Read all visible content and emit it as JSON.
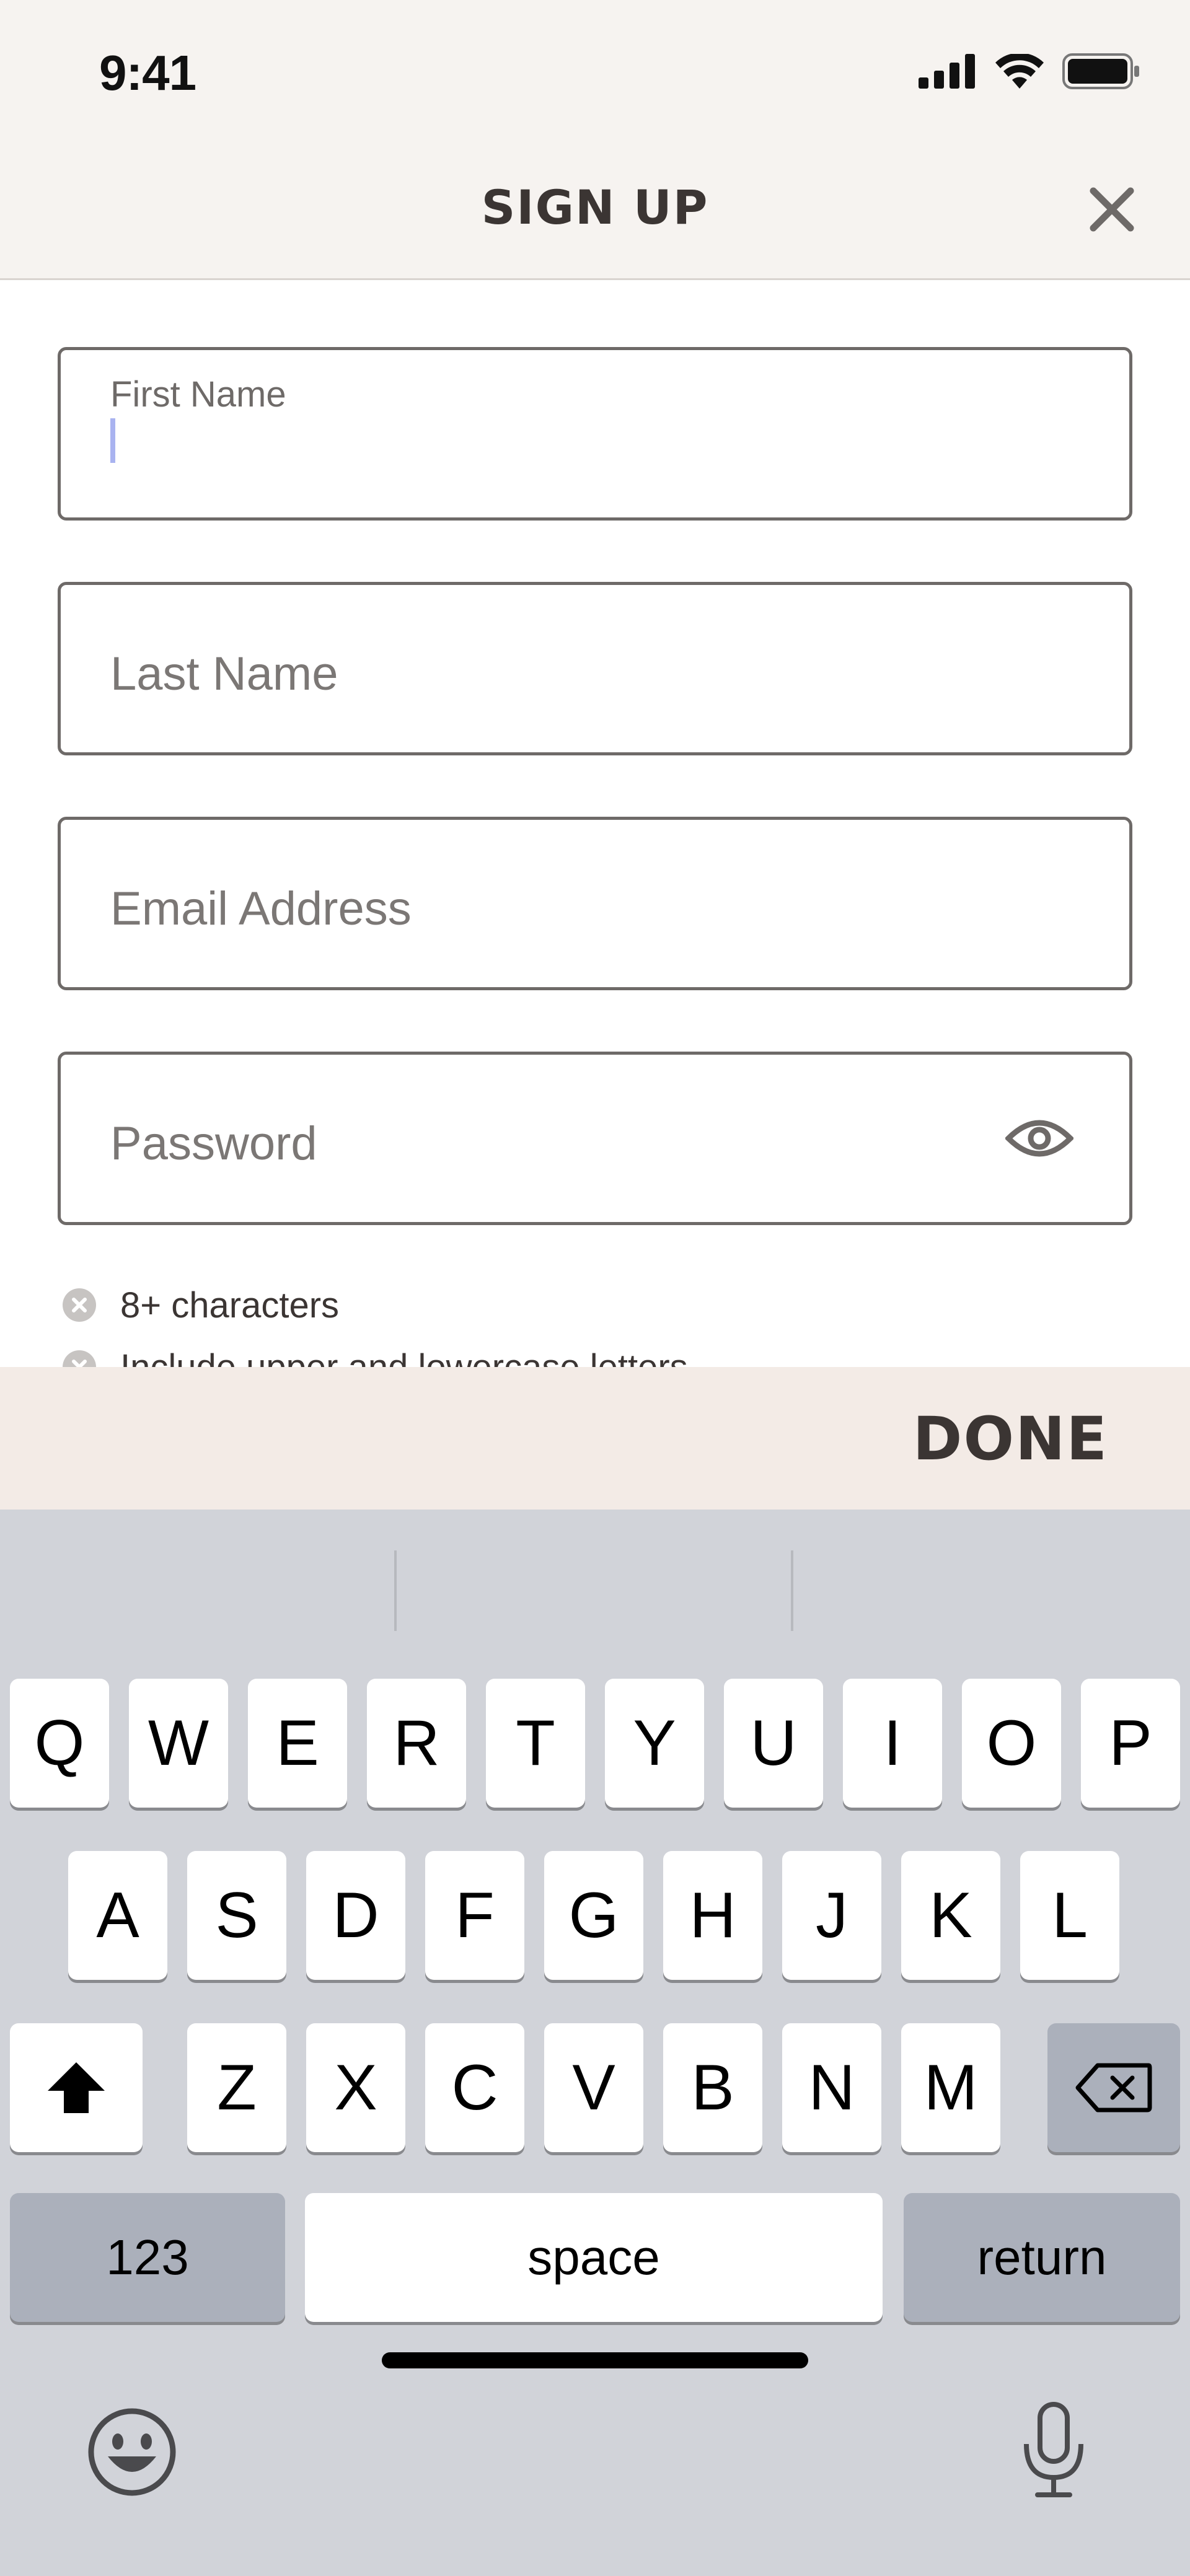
{
  "status_bar": {
    "time": "9:41",
    "icons": [
      "signal-icon",
      "wifi-icon",
      "battery-icon"
    ]
  },
  "header": {
    "title": "SIGN UP",
    "close_icon": "close-icon"
  },
  "form": {
    "first_name_label": "First Name",
    "last_name_placeholder": "Last Name",
    "email_placeholder": "Email Address",
    "password_placeholder": "Password",
    "password_visibility_icon": "eye-icon",
    "rules": [
      {
        "text": "8+ characters",
        "icon": "x-circle-icon"
      },
      {
        "text": "Include upper and lowercase letters",
        "icon": "x-circle-icon"
      }
    ]
  },
  "accessory_bar": {
    "done_label": "DONE"
  },
  "keyboard": {
    "row1": [
      "Q",
      "W",
      "E",
      "R",
      "T",
      "Y",
      "U",
      "I",
      "O",
      "P"
    ],
    "row2": [
      "A",
      "S",
      "D",
      "F",
      "G",
      "H",
      "J",
      "K",
      "L"
    ],
    "row3": [
      "Z",
      "X",
      "C",
      "V",
      "B",
      "N",
      "M"
    ],
    "shift_icon": "shift-icon",
    "delete_icon": "delete-icon",
    "numbers_label": "123",
    "space_label": "space",
    "return_label": "return",
    "emoji_icon": "emoji-icon",
    "mic_icon": "microphone-icon"
  },
  "colors": {
    "accent_caret": "#a9b3f0",
    "header_bg": "#f6f3f0",
    "done_bar_bg": "#f3ebe6",
    "keyboard_bg": "#d1d3d9"
  }
}
